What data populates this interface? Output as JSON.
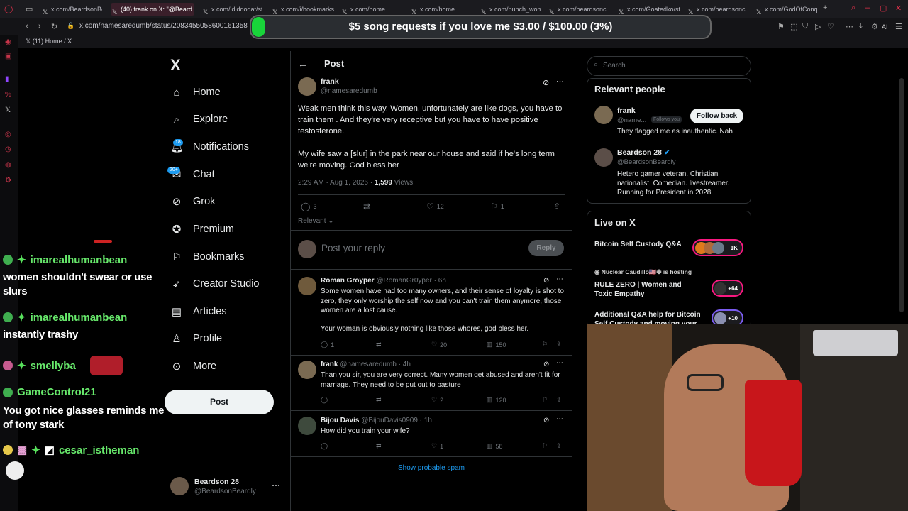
{
  "browser": {
    "tabs": [
      {
        "label": "x.com/BeardsonBe"
      },
      {
        "label": "(40) frank on X: \"@Beard"
      },
      {
        "label": "x.com/ididdodat/st"
      },
      {
        "label": "x.com/i/bookmarks"
      },
      {
        "label": "x.com/home"
      },
      {
        "label": "x.com/home"
      },
      {
        "label": "x.com/punch_wom"
      },
      {
        "label": "x.com/beardsonc"
      },
      {
        "label": "x.com/Goatedko/st"
      },
      {
        "label": "x.com/beardsonc"
      },
      {
        "label": "x.com/GodOfConq"
      }
    ],
    "url": "x.com/namesaredumb/status/2083455058600161358",
    "bookmark": "(11) Home / X",
    "toolbar_ai": "AI"
  },
  "banner": {
    "text": "$5 song requests if you love me $3.00 / $100.00 (3%)",
    "progress_fraction": 0.03
  },
  "nav": {
    "logo": "X",
    "items": [
      {
        "label": "Home",
        "icon": "home-icon"
      },
      {
        "label": "Explore",
        "icon": "search-icon"
      },
      {
        "label": "Notifications",
        "icon": "bell-icon"
      },
      {
        "label": "Chat",
        "icon": "chat-icon"
      },
      {
        "label": "Grok",
        "icon": "grok-icon"
      },
      {
        "label": "Premium",
        "icon": "premium-icon"
      },
      {
        "label": "Bookmarks",
        "icon": "bookmark-icon"
      },
      {
        "label": "Creator Studio",
        "icon": "rocket-icon"
      },
      {
        "label": "Articles",
        "icon": "article-icon"
      },
      {
        "label": "Profile",
        "icon": "person-icon"
      },
      {
        "label": "More",
        "icon": "more-circle-icon"
      }
    ],
    "notif_badge": "18",
    "chat_badge": "20+",
    "post_label": "Post",
    "account": {
      "name": "Beardson 28",
      "handle": "@BeardsonBeardly"
    }
  },
  "chat": [
    {
      "user": "imarealhumanbean",
      "msg": "women shouldn't swear or use slurs"
    },
    {
      "user": "imarealhumanbean",
      "msg": "instantly trashy"
    },
    {
      "user": "smellyba",
      "msg": ""
    },
    {
      "user": "GameControl21",
      "msg": "You got nice glasses reminds me of tony stark"
    },
    {
      "user": "cesar_istheman",
      "msg": ""
    }
  ],
  "post": {
    "header": "Post",
    "author": {
      "name": "frank",
      "handle": "@namesaredumb"
    },
    "text1": "Weak men think this way. Women, unfortunately are like dogs, you have to train them . And they're very receptive but you have to have positive testosterone.",
    "text2": "My wife saw a [slur] in the park near our house and said if he's long term we're moving. God bless her",
    "time": "2:29 AM · Aug 1, 2026 · ",
    "views": "1,599",
    "views_label": " Views",
    "replies": "3",
    "likes": "12",
    "bookmarks": "1",
    "sort_label": "Relevant",
    "reply_placeholder": "Post your reply",
    "reply_btn": "Reply"
  },
  "replies": [
    {
      "name": "Roman Groyper",
      "handle": "@RomanGr0yper · 6h",
      "text": "Some women have had too many owners, and their sense of loyalty is shot to zero, they only worship the self now and you can't train them anymore, those women are a lost cause.",
      "text2": "Your woman is obviously nothing like those whores, god bless her.",
      "replies": "1",
      "likes": "20",
      "views": "150"
    },
    {
      "name": "frank",
      "handle": "@namesaredumb · 4h",
      "text": "Than you sir, you are very correct. Many women get abused and aren't fit for marriage. They need to be put out to pasture",
      "text2": "",
      "replies": "",
      "likes": "2",
      "views": "120"
    },
    {
      "name": "Bijou Davis",
      "handle": "@BijouDavis0909 · 1h",
      "text": "How did you train your wife?",
      "text2": "",
      "replies": "",
      "likes": "1",
      "views": "58"
    }
  ],
  "show_spam": "Show probable spam",
  "right": {
    "search_placeholder": "Search",
    "relevant_title": "Relevant people",
    "people": [
      {
        "name": "frank",
        "handle": "@name...",
        "follows_you": "Follows you",
        "btn": "Follow back",
        "bio": "They flagged me as inauthentic. Nah"
      },
      {
        "name": "Beardson 28",
        "handle": "@BeardsonBeardly",
        "bio": "Hetero gamer veteran. Christian nationalist. Comedian. livestreamer. Running for President in 2028"
      }
    ],
    "live_title": "Live on X",
    "live": [
      {
        "title": "Bitcoin Self Custody Q&A",
        "count": "+1K"
      },
      {
        "host": "Nuclear Caudillo🇺🇸✙ is hosting",
        "title": "RULE ZERO | Women and Toxic Empathy",
        "count": "+64"
      },
      {
        "title": "Additional Q&A help for Bitcoin Self Custody and moving your",
        "count": "+10"
      }
    ]
  },
  "colors": {
    "accent": "#1d9bf0",
    "chat_green": "#67e86b",
    "banner_fill": "#19d43a",
    "live_pink": "#f91880"
  }
}
